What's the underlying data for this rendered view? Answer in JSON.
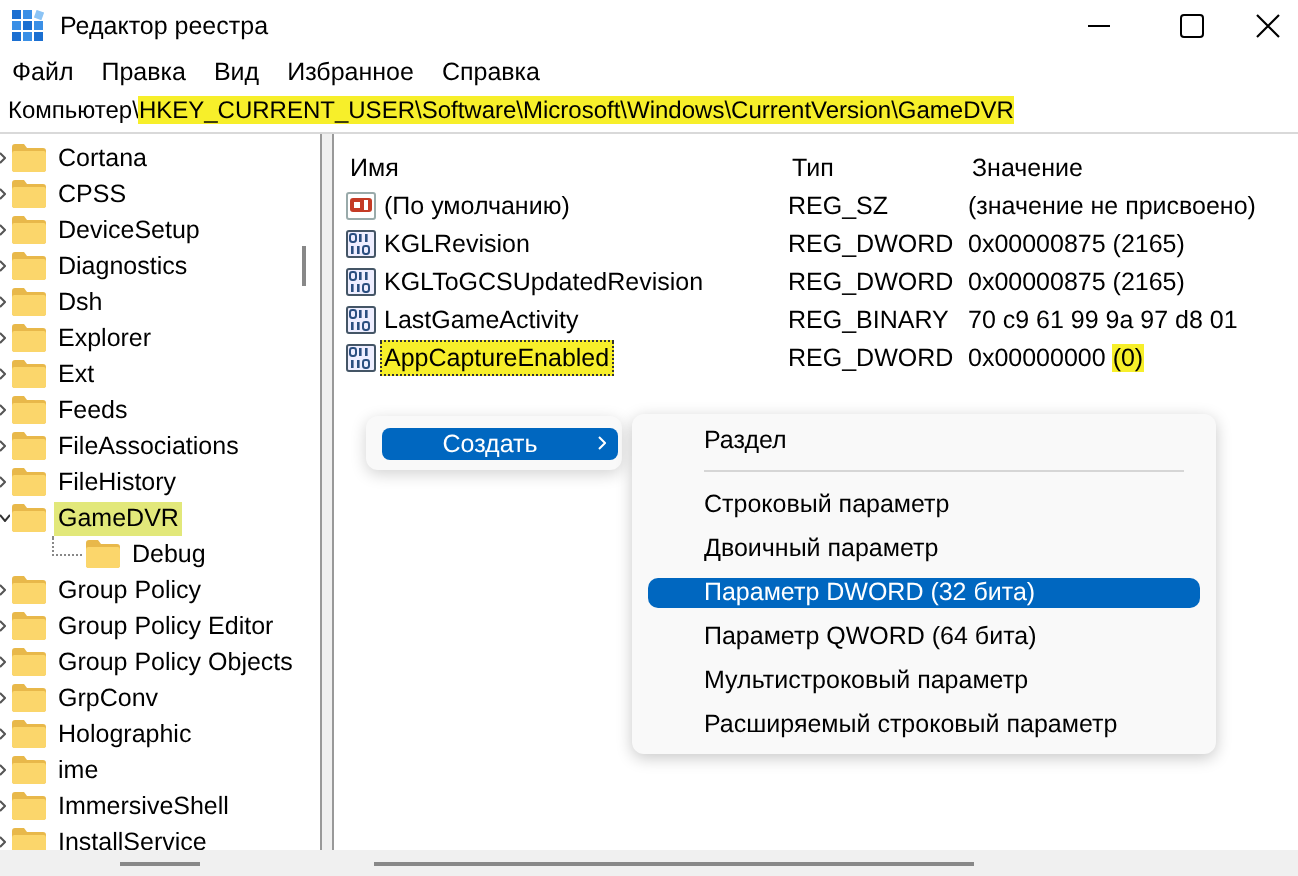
{
  "window": {
    "title": "Редактор реестра"
  },
  "menu": [
    "Файл",
    "Правка",
    "Вид",
    "Избранное",
    "Справка"
  ],
  "address": {
    "prefix": "Компьютер\\",
    "marked": "HKEY_CURRENT_USER\\Software\\Microsoft\\Windows\\CurrentVersion\\GameDVR"
  },
  "tree": [
    {
      "name": "Cortana",
      "expanded": false,
      "selected": false
    },
    {
      "name": "CPSS",
      "expanded": false,
      "selected": false
    },
    {
      "name": "DeviceSetup",
      "expanded": false,
      "selected": false
    },
    {
      "name": "Diagnostics",
      "expanded": false,
      "selected": false
    },
    {
      "name": "Dsh",
      "expanded": false,
      "selected": false
    },
    {
      "name": "Explorer",
      "expanded": false,
      "selected": false
    },
    {
      "name": "Ext",
      "expanded": false,
      "selected": false
    },
    {
      "name": "Feeds",
      "expanded": false,
      "selected": false
    },
    {
      "name": "FileAssociations",
      "expanded": false,
      "selected": false
    },
    {
      "name": "FileHistory",
      "expanded": false,
      "selected": false
    },
    {
      "name": "GameDVR",
      "expanded": true,
      "selected": true,
      "children": [
        {
          "name": "Debug"
        }
      ]
    },
    {
      "name": "Group Policy",
      "expanded": false,
      "selected": false
    },
    {
      "name": "Group Policy Editor",
      "expanded": false,
      "selected": false
    },
    {
      "name": "Group Policy Objects",
      "expanded": false,
      "selected": false
    },
    {
      "name": "GrpConv",
      "expanded": false,
      "selected": false
    },
    {
      "name": "Holographic",
      "expanded": false,
      "selected": false
    },
    {
      "name": "ime",
      "expanded": false,
      "selected": false
    },
    {
      "name": "ImmersiveShell",
      "expanded": false,
      "selected": false
    },
    {
      "name": "InstallService",
      "expanded": false,
      "selected": false
    }
  ],
  "list": {
    "columns": [
      "Имя",
      "Тип",
      "Значение"
    ],
    "rows": [
      {
        "kind": "string",
        "name": "(По умолчанию)",
        "type": "REG_SZ",
        "value": "(значение не присвоено)",
        "selected": false
      },
      {
        "kind": "binary",
        "name": "KGLRevision",
        "type": "REG_DWORD",
        "value": "0x00000875 (2165)",
        "selected": false
      },
      {
        "kind": "binary",
        "name": "KGLToGCSUpdatedRevision",
        "type": "REG_DWORD",
        "value": "0x00000875 (2165)",
        "selected": false
      },
      {
        "kind": "binary",
        "name": "LastGameActivity",
        "type": "REG_BINARY",
        "value": "70 c9 61 99 9a 97 d8 01",
        "selected": false
      },
      {
        "kind": "binary",
        "name": "AppCaptureEnabled",
        "type": "REG_DWORD",
        "value": "0x00000000",
        "value_marked": "(0)",
        "selected": true
      }
    ]
  },
  "context_menu": {
    "items": [
      {
        "label": "Создать",
        "selected": true
      }
    ],
    "submenu": [
      {
        "kind": "item",
        "label": "Раздел",
        "selected": false
      },
      {
        "kind": "separator"
      },
      {
        "kind": "item",
        "label": "Строковый параметр",
        "selected": false
      },
      {
        "kind": "item",
        "label": "Двоичный параметр",
        "selected": false
      },
      {
        "kind": "item",
        "label": "Параметр DWORD (32 бита)",
        "selected": true
      },
      {
        "kind": "item",
        "label": "Параметр QWORD (64 бита)",
        "selected": false
      },
      {
        "kind": "item",
        "label": "Мультистроковый параметр",
        "selected": false
      },
      {
        "kind": "item",
        "label": "Расширяемый строковый параметр",
        "selected": false
      }
    ]
  }
}
